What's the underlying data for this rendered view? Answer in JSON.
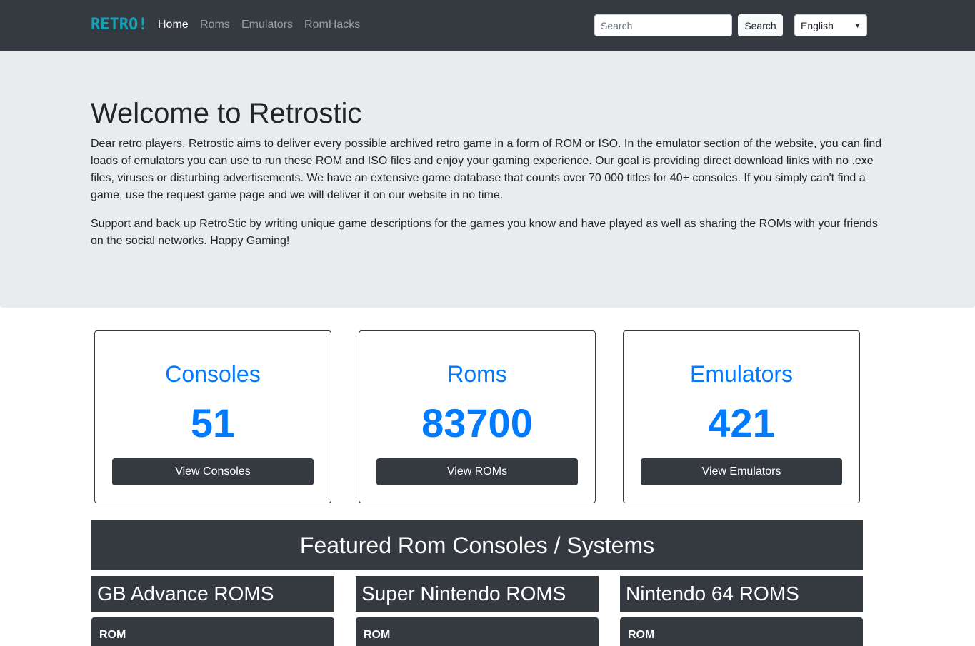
{
  "navbar": {
    "brand": "RETRO!",
    "links": [
      {
        "label": "Home",
        "active": true
      },
      {
        "label": "Roms",
        "active": false
      },
      {
        "label": "Emulators",
        "active": false
      },
      {
        "label": "RomHacks",
        "active": false
      }
    ],
    "search_placeholder": "Search",
    "search_button": "Search",
    "language": "English"
  },
  "jumbotron": {
    "title": "Welcome to Retrostic",
    "paragraph1": "Dear retro players, Retrostic aims to deliver every possible archived retro game in a form of ROM or ISO. In the emulator section of the website, you can find loads of emulators you can use to run these ROM and ISO files and enjoy your gaming experience. Our goal is providing direct download links with no .exe files, viruses or disturbing advertisements. We have an extensive game database that counts over 70 000 titles for 40+ consoles. If you simply can't find a game, use the request game page and we will deliver it on our website in no time.",
    "paragraph2": "Support and back up RetroStic by writing unique game descriptions for the games you know and have played as well as sharing the ROMs with your friends on the social networks. Happy Gaming!"
  },
  "stats": [
    {
      "title": "Consoles",
      "count": "51",
      "button": "View Consoles"
    },
    {
      "title": "Roms",
      "count": "83700",
      "button": "View ROMs"
    },
    {
      "title": "Emulators",
      "count": "421",
      "button": "View Emulators"
    }
  ],
  "featured": {
    "title": "Featured Rom Consoles / Systems",
    "systems": [
      {
        "name": "GB Advance ROMS",
        "sub": "ROM"
      },
      {
        "name": "Super Nintendo ROMS",
        "sub": "ROM"
      },
      {
        "name": "Nintendo 64 ROMS",
        "sub": "ROM"
      }
    ]
  },
  "colors": {
    "navbar_bg": "#343a40",
    "brand": "#17a2b8",
    "jumbotron_bg": "#e9ecef",
    "accent": "#007bff"
  }
}
